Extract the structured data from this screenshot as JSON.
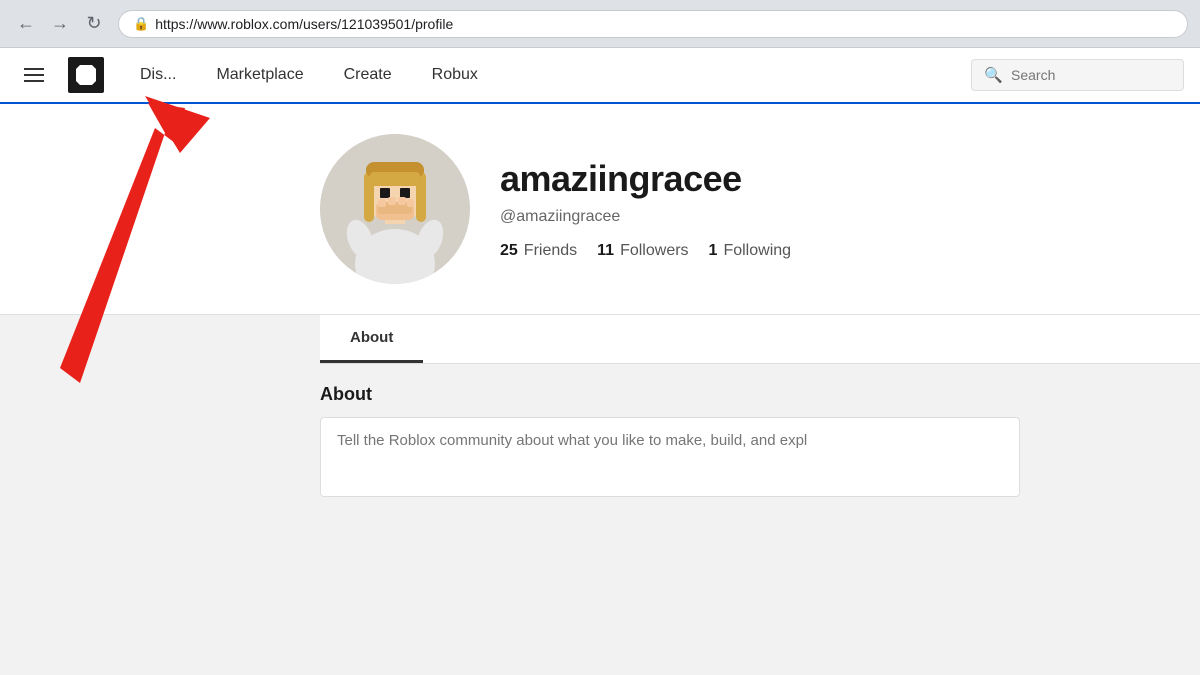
{
  "browser": {
    "back_btn": "←",
    "forward_btn": "→",
    "refresh_btn": "↻",
    "url": "https://www.roblox.com/users/121039501/profile",
    "lock_icon": "🔒"
  },
  "navbar": {
    "hamburger_label": "Menu",
    "logo_label": "Roblox Logo",
    "nav_items": [
      {
        "label": "Dis...",
        "id": "discover"
      },
      {
        "label": "Marketplace",
        "id": "marketplace"
      },
      {
        "label": "Create",
        "id": "create"
      },
      {
        "label": "Robux",
        "id": "robux"
      }
    ],
    "search_placeholder": "Search"
  },
  "profile": {
    "username": "amaziingracee",
    "handle": "@amaziingracee",
    "stats": {
      "friends_count": "25",
      "friends_label": "Friends",
      "followers_count": "11",
      "followers_label": "Followers",
      "following_count": "1",
      "following_label": "Following"
    }
  },
  "about": {
    "tab_label": "About",
    "section_title": "About",
    "placeholder": "Tell the Roblox community about what you like to make, build, and expl"
  }
}
